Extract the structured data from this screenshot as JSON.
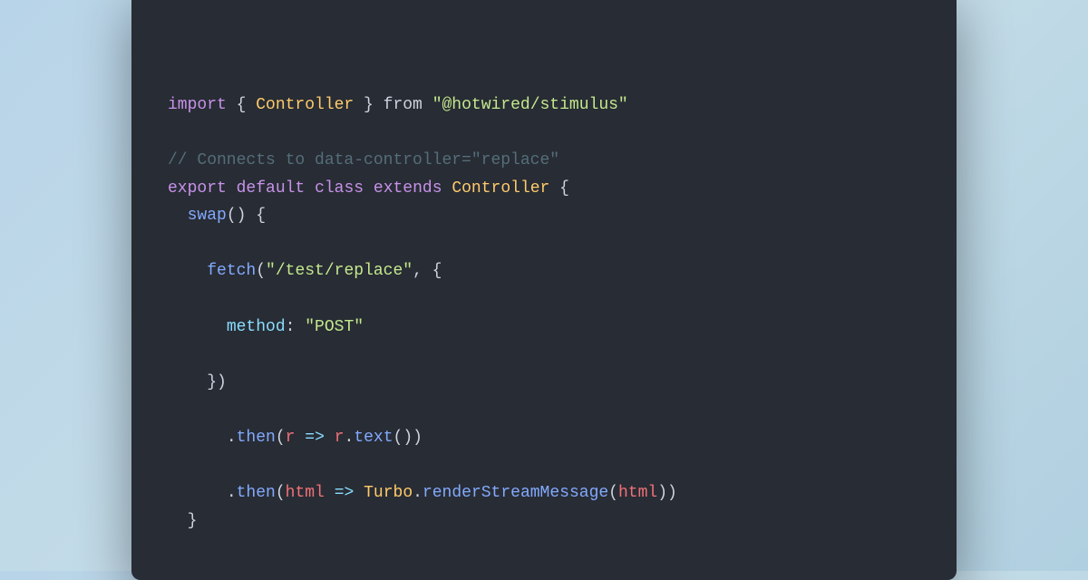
{
  "code": {
    "lines": [
      {
        "id": "import-line",
        "parts": [
          {
            "type": "keyword",
            "text": "import"
          },
          {
            "type": "plain",
            "text": " { "
          },
          {
            "type": "class-name",
            "text": "Controller"
          },
          {
            "type": "plain",
            "text": " } "
          },
          {
            "type": "plain",
            "text": "from"
          },
          {
            "type": "plain",
            "text": " "
          },
          {
            "type": "string",
            "text": "\"@hotwired/stimulus\""
          }
        ]
      },
      {
        "id": "blank-1",
        "parts": []
      },
      {
        "id": "comment-line",
        "parts": [
          {
            "type": "comment",
            "text": "// Connects to data-controller=\"replace\""
          }
        ]
      },
      {
        "id": "export-line",
        "parts": [
          {
            "type": "keyword",
            "text": "export"
          },
          {
            "type": "plain",
            "text": " "
          },
          {
            "type": "keyword",
            "text": "default"
          },
          {
            "type": "plain",
            "text": " "
          },
          {
            "type": "keyword",
            "text": "class"
          },
          {
            "type": "plain",
            "text": " "
          },
          {
            "type": "keyword",
            "text": "extends"
          },
          {
            "type": "plain",
            "text": " "
          },
          {
            "type": "class-name",
            "text": "Controller"
          },
          {
            "type": "plain",
            "text": " {"
          }
        ]
      },
      {
        "id": "swap-line",
        "indent": "  ",
        "parts": [
          {
            "type": "method",
            "text": "swap"
          },
          {
            "type": "plain",
            "text": "() {"
          }
        ]
      },
      {
        "id": "blank-2",
        "parts": []
      },
      {
        "id": "fetch-line",
        "indent": "    ",
        "parts": [
          {
            "type": "method",
            "text": "fetch"
          },
          {
            "type": "plain",
            "text": "("
          },
          {
            "type": "string",
            "text": "\"/test/replace\""
          },
          {
            "type": "plain",
            "text": ", {"
          }
        ]
      },
      {
        "id": "blank-3",
        "parts": []
      },
      {
        "id": "method-line",
        "indent": "      ",
        "parts": [
          {
            "type": "property",
            "text": "method"
          },
          {
            "type": "plain",
            "text": ": "
          },
          {
            "type": "value",
            "text": "\"POST\""
          }
        ]
      },
      {
        "id": "blank-4",
        "parts": []
      },
      {
        "id": "close-fetch",
        "indent": "    ",
        "parts": [
          {
            "type": "plain",
            "text": "})"
          }
        ]
      },
      {
        "id": "blank-5",
        "parts": []
      },
      {
        "id": "then-1",
        "indent": "      ",
        "parts": [
          {
            "type": "plain",
            "text": "."
          },
          {
            "type": "method",
            "text": "then"
          },
          {
            "type": "plain",
            "text": "("
          },
          {
            "type": "param",
            "text": "r"
          },
          {
            "type": "plain",
            "text": " "
          },
          {
            "type": "arrow",
            "text": "=>"
          },
          {
            "type": "plain",
            "text": " "
          },
          {
            "type": "param",
            "text": "r"
          },
          {
            "type": "plain",
            "text": "."
          },
          {
            "type": "method",
            "text": "text"
          },
          {
            "type": "plain",
            "text": "())"
          }
        ]
      },
      {
        "id": "blank-6",
        "parts": []
      },
      {
        "id": "then-2",
        "indent": "      ",
        "parts": [
          {
            "type": "plain",
            "text": "."
          },
          {
            "type": "method",
            "text": "then"
          },
          {
            "type": "plain",
            "text": "("
          },
          {
            "type": "param",
            "text": "html"
          },
          {
            "type": "plain",
            "text": " "
          },
          {
            "type": "arrow",
            "text": "=>"
          },
          {
            "type": "plain",
            "text": " "
          },
          {
            "type": "turbo",
            "text": "Turbo"
          },
          {
            "type": "plain",
            "text": "."
          },
          {
            "type": "method",
            "text": "renderStreamMessage"
          },
          {
            "type": "plain",
            "text": "("
          },
          {
            "type": "param",
            "text": "html"
          },
          {
            "type": "plain",
            "text": "))"
          }
        ]
      },
      {
        "id": "close-swap",
        "indent": "  ",
        "parts": [
          {
            "type": "plain",
            "text": "}"
          }
        ]
      }
    ]
  }
}
